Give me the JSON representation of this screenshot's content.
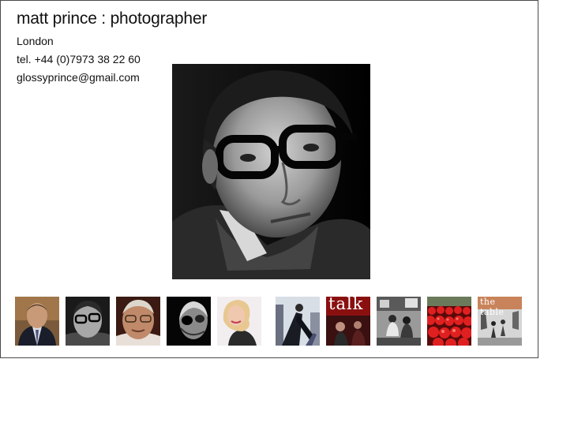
{
  "header": {
    "title": "matt prince : photographer",
    "city": "London",
    "phone": "tel. +44 (0)7973 38 22 60",
    "email": "glossyprince@gmail.com"
  },
  "main_image": {
    "icon": "portrait-photo"
  },
  "thumbnails": [
    {
      "icon": "portrait-man-suit-thumb"
    },
    {
      "icon": "portrait-glasses-man-thumb"
    },
    {
      "icon": "portrait-older-man-thumb"
    },
    {
      "icon": "portrait-dark-man-thumb"
    },
    {
      "icon": "portrait-woman-blonde-thumb"
    },
    {
      "icon": "figure-cityscape-thumb"
    },
    {
      "icon": "magazine-cover-thumb",
      "text": "talk"
    },
    {
      "icon": "street-scene-thumb"
    },
    {
      "icon": "red-tomatoes-thumb"
    },
    {
      "icon": "book-cover-thumb",
      "text": "the table"
    }
  ],
  "colors": {
    "border": "#4a4a4a",
    "text": "#111111",
    "talk_red": "#b01818",
    "table_orange": "#c9835a"
  }
}
